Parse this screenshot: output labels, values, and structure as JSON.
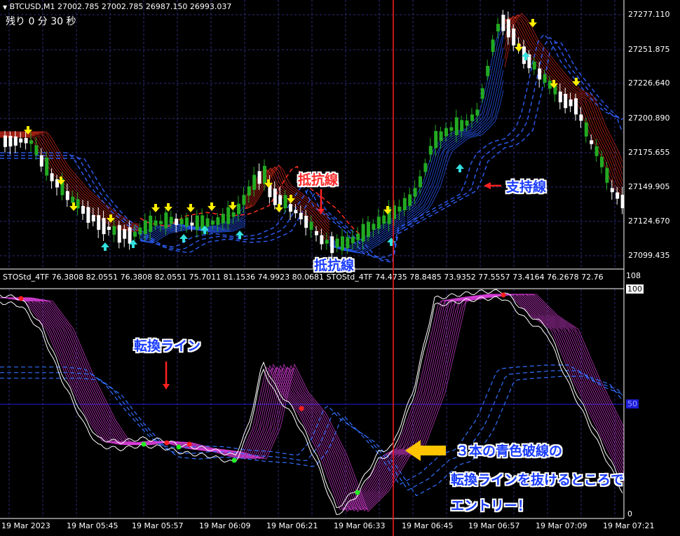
{
  "window": {
    "symbol_header": "BTCUSD,M1  27002.785 27002.785 26987.150 26993.037",
    "countdown": "残り  0 分  30 秒"
  },
  "price_axis": {
    "labels": [
      "27277.110",
      "27251.875",
      "27226.640",
      "27200.890",
      "27175.655",
      "27149.905",
      "27124.670",
      "27099.435"
    ]
  },
  "indicator": {
    "header": "STOStd_4TF 76.3808 82.0551 76.3808 82.0551 75.7011 81.1536 74.9923 80.0681  STOStd_4TF 74.4735 78.8485 73.9352 77.5557 73.4164 76.2678 72.76",
    "scale_labels": [
      "108",
      "100",
      "50",
      "0"
    ]
  },
  "time_axis": {
    "labels": [
      "19 Mar 2023",
      "19 Mar 05:45",
      "19 Mar 05:57",
      "19 Mar 06:09",
      "19 Mar 06:21",
      "19 Mar 06:33",
      "19 Mar 06:45",
      "19 Mar 06:57",
      "19 Mar 07:09",
      "19 Mar 07:21"
    ]
  },
  "annotations": {
    "resistance_top": "抵抗線",
    "resistance_bottom": "抵抗線",
    "support": "支持線",
    "turn_line": "転換ライン",
    "entry_line1": "３本の青色破線の",
    "entry_line2": "転換ラインを抜けるところで",
    "entry_line3": "エントリー！"
  },
  "colors": {
    "background": "#000000",
    "bull_candle": "#22aa22",
    "bear_candle": "#ffffff",
    "cursor_line": "#ff1a1a",
    "resistance_band": "#d12a1a",
    "support_band": "#2a5cff",
    "stoch_fast": "#e040e0",
    "up_arrow": "#33e0e0",
    "down_arrow": "#ffee00",
    "entry_arrow": "#ffc400"
  }
}
